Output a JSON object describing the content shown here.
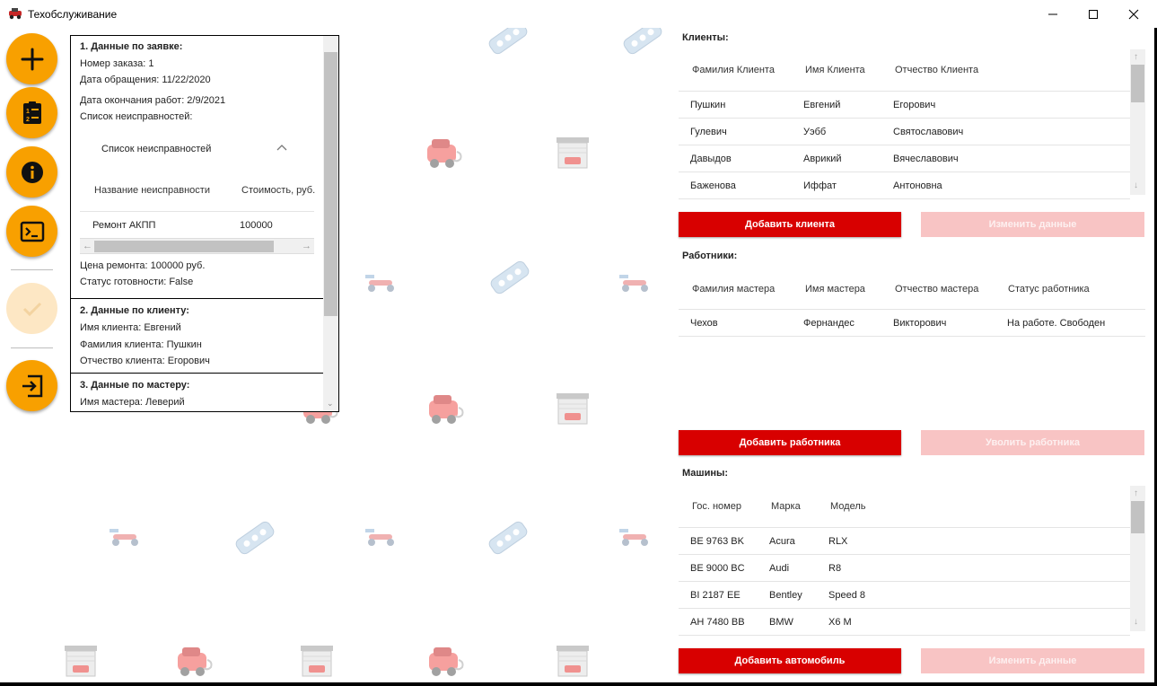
{
  "window": {
    "title": "Техобслуживание",
    "controls": [
      "minimize",
      "maximize",
      "close"
    ]
  },
  "sidebar": {
    "actions": [
      {
        "icon": "plus-icon",
        "enabled": true
      },
      {
        "icon": "numbered-list-icon",
        "enabled": true
      },
      {
        "icon": "info-icon",
        "enabled": true
      },
      {
        "icon": "terminal-icon",
        "enabled": true
      },
      {
        "icon": "checkmark-icon",
        "enabled": false
      },
      {
        "icon": "logout-icon",
        "enabled": true
      }
    ],
    "accent_color": "#f8a000"
  },
  "order": {
    "section1_title": "1. Данные по заявке:",
    "order_number": "Номер заказа: 1",
    "request_date": "Дата обращения: 11/22/2020",
    "end_date": "Дата окончания работ: 2/9/2021",
    "faults_label": "Список неисправностей:",
    "faults_group_title": "Список неисправностей",
    "faults_columns": [
      "Название неисправности",
      "Стоимость, руб."
    ],
    "faults_rows": [
      {
        "name": "Ремонт АКПП",
        "cost": "100000"
      }
    ],
    "repair_price": "Цена ремонта: 100000 руб.",
    "ready_status": "Статус готовности: False",
    "section2_title": "2. Данные по клиенту:",
    "client_first": "Имя клиента: Евгений",
    "client_last": "Фамилия клиента: Пушкин",
    "client_middle": "Отчество клиента: Егорович",
    "section3_title": "3. Данные по мастеру:",
    "master_first": "Имя мастера: Леверий"
  },
  "clients": {
    "title": "Клиенты:",
    "columns": [
      "Фамилия Клиента",
      "Имя Клиента",
      "Отчество Клиента"
    ],
    "rows": [
      [
        "Пушкин",
        "Евгений",
        "Егорович"
      ],
      [
        "Гулевич",
        "Уэбб",
        "Святославович"
      ],
      [
        "Давыдов",
        "Аврикий",
        "Вячеславович"
      ],
      [
        "Баженова",
        "Иффат",
        "Антоновна"
      ]
    ],
    "add_label": "Добавить клиента",
    "edit_label": "Изменить данные"
  },
  "workers": {
    "title": "Работники:",
    "columns": [
      "Фамилия мастера",
      "Имя мастера",
      "Отчество мастера",
      "Статус работника"
    ],
    "rows": [
      [
        "Чехов",
        "Фернандес",
        "Викторович",
        "На работе. Свободен"
      ]
    ],
    "add_label": "Добавить работника",
    "fire_label": "Уволить работника"
  },
  "cars": {
    "title": "Машины:",
    "columns": [
      "Гос. номер",
      "Марка",
      "Модель"
    ],
    "rows": [
      [
        "BE 9763 BK",
        "Acura",
        "RLX"
      ],
      [
        "BE 9000 BC",
        "Audi",
        "R8"
      ],
      [
        "BI 2187 EE",
        "Bentley",
        "Speed 8"
      ],
      [
        "AH 7480 BB",
        "BMW",
        "X6 M"
      ]
    ],
    "add_label": "Добавить автомобиль",
    "edit_label": "Изменить данные"
  },
  "colors": {
    "primary_button": "#d80000",
    "disabled_button": "#f8c4c4"
  }
}
